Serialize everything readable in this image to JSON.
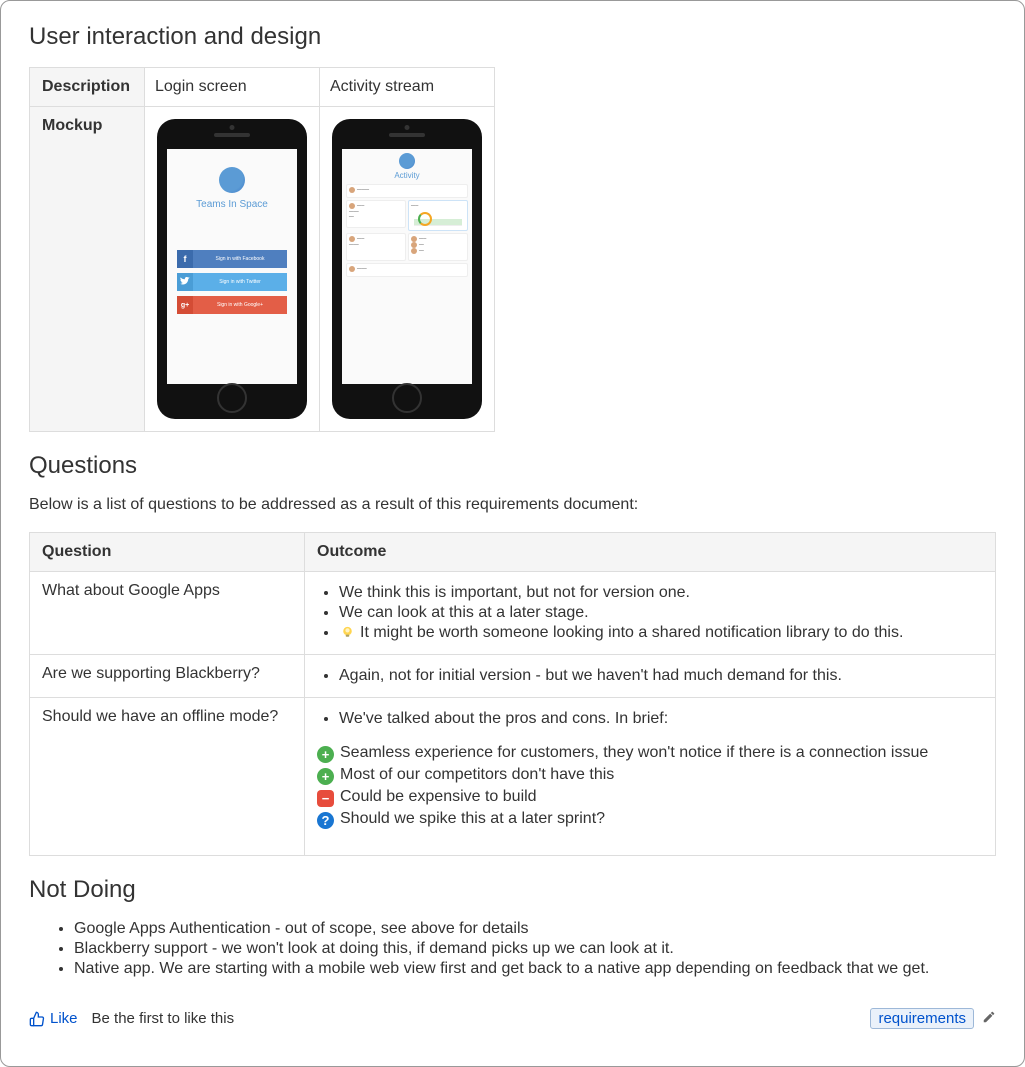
{
  "designSection": {
    "heading": "User interaction and design",
    "table": {
      "row1header": "Description",
      "row2header": "Mockup",
      "col1": "Login screen",
      "col2": "Activity stream"
    },
    "login": {
      "appName": "Teams In Space",
      "fb": "Sign in with Facebook",
      "tw": "Sign in with Twitter",
      "gp": "Sign in with Google+"
    },
    "activity": {
      "title": "Activity"
    }
  },
  "questionsSection": {
    "heading": "Questions",
    "intro": "Below is a list of questions to be addressed as a result of this requirements document:",
    "headers": {
      "q": "Question",
      "o": "Outcome"
    },
    "rows": [
      {
        "question": "What about Google Apps",
        "bullets": [
          "We think this is important, but not for version one.",
          "We can look at this at a later stage."
        ],
        "bulbItem": "It might be worth someone looking into a shared notification library to do this."
      },
      {
        "question": "Are we supporting Blackberry?",
        "bullets": [
          "Again, not for initial version - but we haven't had much demand for this."
        ]
      },
      {
        "question": "Should we have an offline mode?",
        "intro": "We've talked about the pros and cons. In brief:",
        "items": [
          {
            "icon": "plus",
            "text": "Seamless experience for customers, they won't notice if there is a connection issue"
          },
          {
            "icon": "plus",
            "text": "Most of our competitors don't have this"
          },
          {
            "icon": "minus",
            "text": "Could be expensive to build"
          },
          {
            "icon": "qmark",
            "text": "Should we spike this at a later sprint?"
          }
        ]
      }
    ]
  },
  "notDoingSection": {
    "heading": "Not Doing",
    "items": [
      "Google Apps Authentication - out of scope, see above for details",
      "Blackberry support - we won't look at doing this, if demand picks up we can look at it.",
      "Native app. We are starting with a mobile web view first and get back to a native app depending on feedback that we get."
    ]
  },
  "footer": {
    "like": "Like",
    "hint": "Be the first to like this",
    "tag": "requirements"
  }
}
